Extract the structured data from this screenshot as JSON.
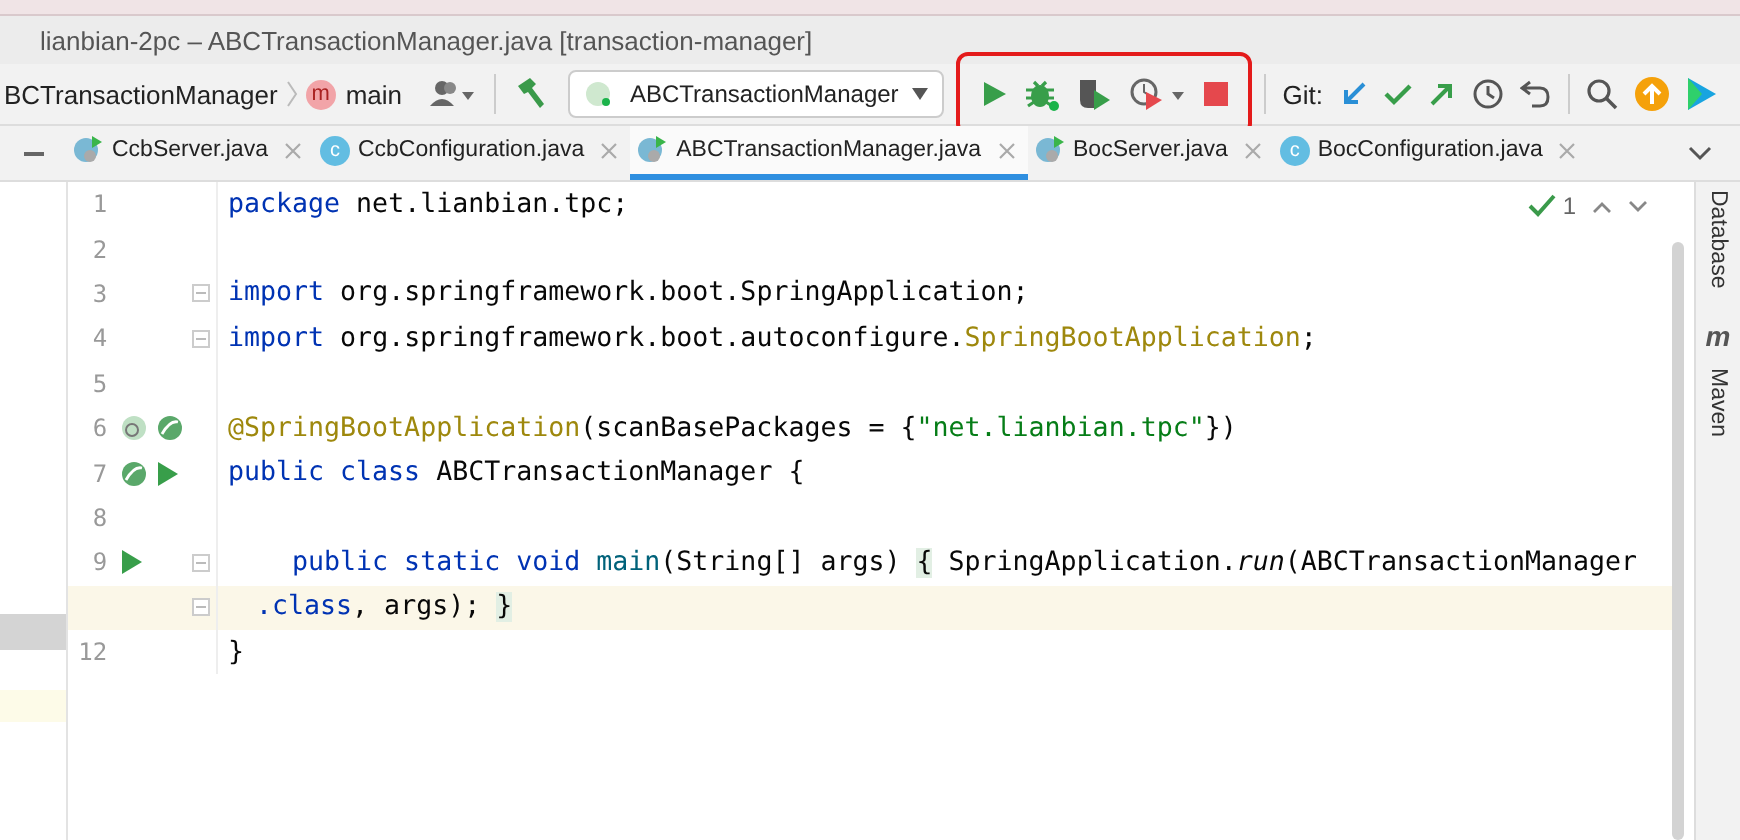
{
  "window": {
    "title": "lianbian-2pc – ABCTransactionManager.java [transaction-manager]"
  },
  "toolbar": {
    "breadcrumbs": [
      {
        "kind": "class",
        "label": "BCTransactionManager"
      },
      {
        "kind": "method",
        "icon_letter": "m",
        "label": "main"
      }
    ],
    "run_configuration": "ABCTransactionManager",
    "run_actions_highlighted": true,
    "run_actions": [
      {
        "kind": "run"
      },
      {
        "kind": "debug"
      },
      {
        "kind": "coverage"
      },
      {
        "kind": "profile"
      },
      {
        "kind": "stop"
      }
    ],
    "git_label": "Git:",
    "git_actions": [
      {
        "kind": "update"
      },
      {
        "kind": "commit"
      },
      {
        "kind": "push"
      },
      {
        "kind": "history"
      },
      {
        "kind": "rollback"
      }
    ],
    "extra_actions": [
      {
        "kind": "search"
      },
      {
        "kind": "upload"
      },
      {
        "kind": "logo"
      }
    ]
  },
  "tabs": [
    {
      "label": "CcbServer.java",
      "kind": "spring",
      "selected": false
    },
    {
      "label": "CcbConfiguration.java",
      "kind": "class",
      "icon_letter": "c",
      "selected": false
    },
    {
      "label": "ABCTransactionManager.java",
      "kind": "spring",
      "selected": true
    },
    {
      "label": "BocServer.java",
      "kind": "spring",
      "selected": false
    },
    {
      "label": "BocConfiguration.java",
      "kind": "class",
      "icon_letter": "c",
      "selected": false
    }
  ],
  "editor": {
    "inspection_count": "1",
    "lines": [
      {
        "number": "1",
        "segments": [
          {
            "t": "package",
            "kind": "keyword"
          },
          {
            "t": " net.lianbian.tpc;",
            "kind": "plain"
          }
        ]
      },
      {
        "number": "2"
      },
      {
        "number": "3",
        "fold": true,
        "segments": [
          {
            "t": "import",
            "kind": "keyword"
          },
          {
            "t": " org.springframework.boot.SpringApplication;",
            "kind": "plain"
          }
        ]
      },
      {
        "number": "4",
        "fold": true,
        "segments": [
          {
            "t": "import",
            "kind": "keyword"
          },
          {
            "t": " org.springframework.boot.autoconfigure.",
            "kind": "plain"
          },
          {
            "t": "SpringBootApplication",
            "kind": "annotation"
          },
          {
            "t": ";",
            "kind": "plain"
          }
        ]
      },
      {
        "number": "5"
      },
      {
        "number": "6",
        "markers": [
          {
            "kind": "bean-search"
          },
          {
            "kind": "bean"
          }
        ],
        "segments": [
          {
            "t": "@SpringBootApplication",
            "kind": "annotation"
          },
          {
            "t": "(scanBasePackages = {",
            "kind": "plain"
          },
          {
            "t": "\"net.lianbian.tpc\"",
            "kind": "string"
          },
          {
            "t": "})",
            "kind": "plain"
          }
        ]
      },
      {
        "number": "7",
        "markers": [
          {
            "kind": "bean"
          },
          {
            "kind": "run"
          }
        ],
        "segments": [
          {
            "t": "public class",
            "kind": "keyword"
          },
          {
            "t": " ABCTransactionManager {",
            "kind": "plain"
          }
        ]
      },
      {
        "number": "8"
      },
      {
        "number": "9",
        "fold": true,
        "markers": [
          {
            "kind": "run"
          }
        ],
        "segments": [
          {
            "t": "    public static void",
            "kind": "keyword"
          },
          {
            "t": " main",
            "kind": "method"
          },
          {
            "t": "(String[] args) ",
            "kind": "plain"
          },
          {
            "t": "{",
            "kind": "brace"
          },
          {
            "t": " SpringApplication.",
            "kind": "plain"
          },
          {
            "t": "run",
            "kind": "italic"
          },
          {
            "t": "(ABCTransactionManager",
            "kind": "plain"
          }
        ]
      },
      {
        "wrapped": true,
        "current": true,
        "fold": true,
        "segments": [
          {
            "t": ".class",
            "kind": "keyword"
          },
          {
            "t": ", args); ",
            "kind": "plain"
          },
          {
            "t": "}",
            "kind": "brace"
          }
        ]
      },
      {
        "number": "12",
        "segments": [
          {
            "t": "}",
            "kind": "plain"
          }
        ]
      }
    ]
  },
  "side_tools": [
    {
      "label": "Database"
    },
    {
      "label": "Maven",
      "icon_letter": "m"
    }
  ]
}
